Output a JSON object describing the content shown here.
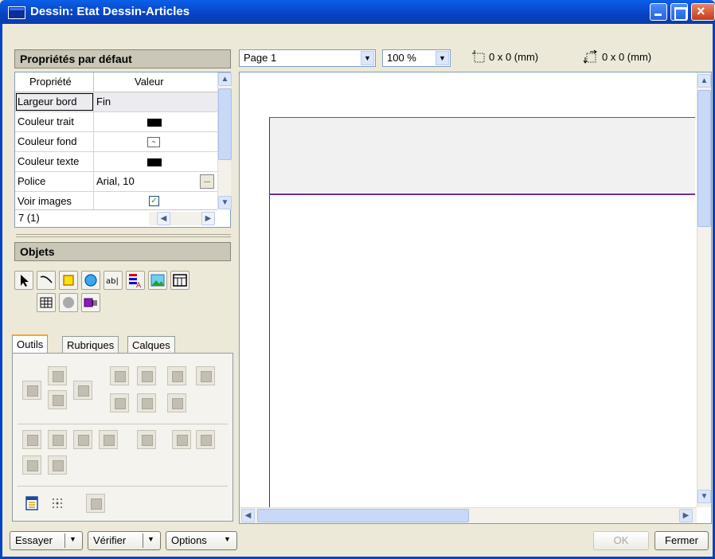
{
  "window": {
    "title": "Dessin: Etat Dessin-Articles"
  },
  "properties": {
    "header": "Propriétés par défaut",
    "col_property": "Propriété",
    "col_value": "Valeur",
    "rows": [
      {
        "name": "Largeur bord",
        "value": "Fin"
      },
      {
        "name": "Couleur trait",
        "value": ""
      },
      {
        "name": "Couleur fond",
        "value": ""
      },
      {
        "name": "Couleur texte",
        "value": ""
      },
      {
        "name": "Police",
        "value": "Arial, 10"
      },
      {
        "name": "Voir images",
        "value": ""
      }
    ],
    "count": "7 (1)",
    "ellipsis": "..."
  },
  "objects": {
    "header": "Objets"
  },
  "tabs": [
    "Outils",
    "Rubriques",
    "Calques"
  ],
  "toolbar": {
    "page_value": "Page 1",
    "zoom_value": "100 %",
    "size_readout": "0 x 0 (mm)",
    "position_readout": "0 x 0 (mm)"
  },
  "footer": {
    "try_label": "Essayer",
    "verify_label": "Vérifier",
    "options_label": "Options",
    "ok_label": "OK",
    "close_label": "Fermer"
  },
  "colors": {
    "accent": "#0842c4",
    "red_line": "#e0262b",
    "blue_line": "#2030c0"
  }
}
